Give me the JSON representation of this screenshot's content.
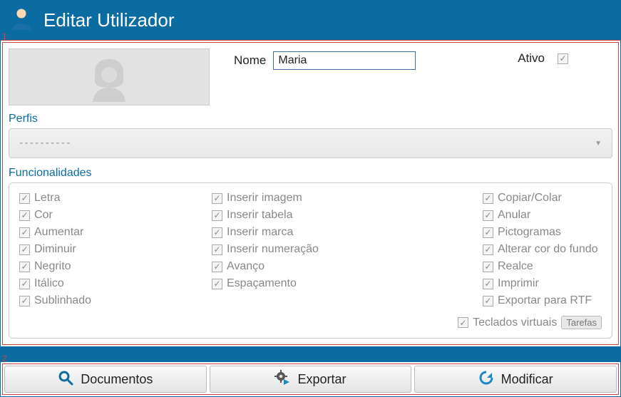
{
  "title": "Editar Utilizador",
  "markers": {
    "one": "1",
    "two": "2"
  },
  "name": {
    "label": "Nome",
    "value": "Maria"
  },
  "active": {
    "label": "Ativo",
    "checked": true
  },
  "perfis": {
    "label": "Perfis",
    "value": "----------"
  },
  "func": {
    "label": "Funcionalidades",
    "col1": [
      "Letra",
      "Cor",
      "Aumentar",
      "Diminuir",
      "Negrito",
      "Itálico",
      "Sublinhado"
    ],
    "col2": [
      "Inserir imagem",
      "Inserir tabela",
      "Inserir marca",
      "Inserir numeração",
      "Avanço",
      "Espaçamento"
    ],
    "col3": [
      "Copiar/Colar",
      "Anular",
      "Pictogramas",
      "Alterar cor do fundo",
      "Realce",
      "Imprimir",
      "Exportar para RTF"
    ],
    "keyboards": "Teclados virtuais",
    "tarefas": "Tarefas"
  },
  "buttons": {
    "documentos": "Documentos",
    "exportar": "Exportar",
    "modificar": "Modificar"
  }
}
